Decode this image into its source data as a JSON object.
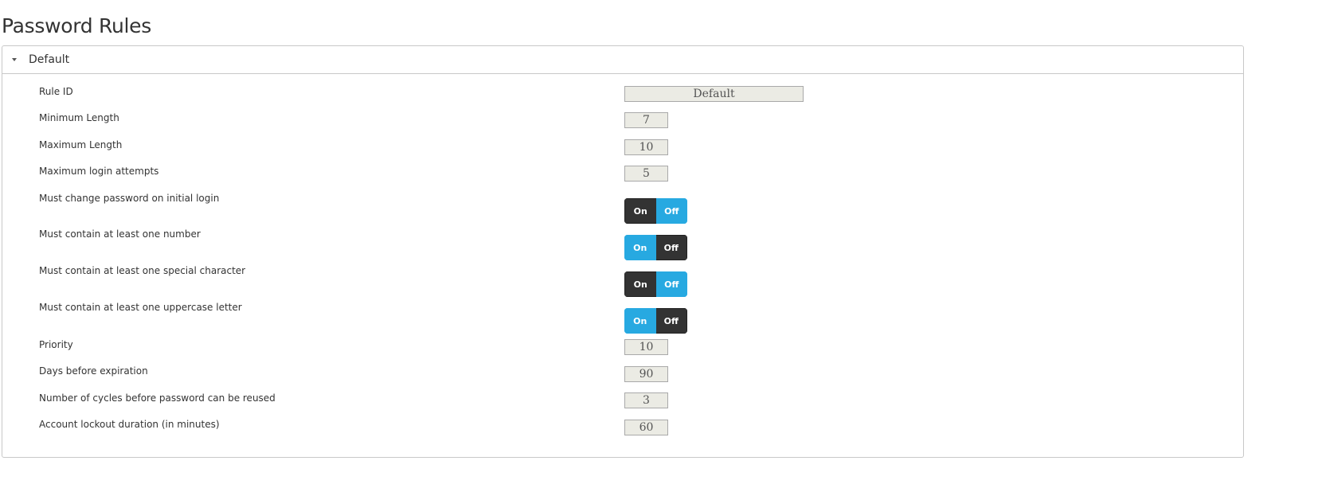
{
  "page": {
    "title": "Password Rules"
  },
  "panel": {
    "title": "Default",
    "expanded": true
  },
  "rules": {
    "rule_id": {
      "label": "Rule ID",
      "value": "Default"
    },
    "min_length": {
      "label": "Minimum Length",
      "value": "7"
    },
    "max_length": {
      "label": "Maximum Length",
      "value": "10"
    },
    "max_login_attempts": {
      "label": "Maximum login attempts",
      "value": "5"
    },
    "must_change_initial": {
      "label": "Must change password on initial login",
      "on_label": "On",
      "off_label": "Off",
      "state": "on"
    },
    "must_number": {
      "label": "Must contain at least one number",
      "on_label": "On",
      "off_label": "Off",
      "state": "off"
    },
    "must_special": {
      "label": "Must contain at least one special character",
      "on_label": "On",
      "off_label": "Off",
      "state": "on"
    },
    "must_uppercase": {
      "label": "Must contain at least one uppercase letter",
      "on_label": "On",
      "off_label": "Off",
      "state": "off"
    },
    "priority": {
      "label": "Priority",
      "value": "10"
    },
    "days_before_expiration": {
      "label": "Days before expiration",
      "value": "90"
    },
    "reuse_cycles": {
      "label": "Number of cycles before password can be reused",
      "value": "3"
    },
    "lockout_duration": {
      "label": "Account lockout duration (in minutes)",
      "value": "60"
    }
  },
  "colors": {
    "toggle_active_dark": "#333333",
    "toggle_inactive_blue": "#27a9e1",
    "field_background": "#ebebe4",
    "border": "#c8c8c8"
  }
}
